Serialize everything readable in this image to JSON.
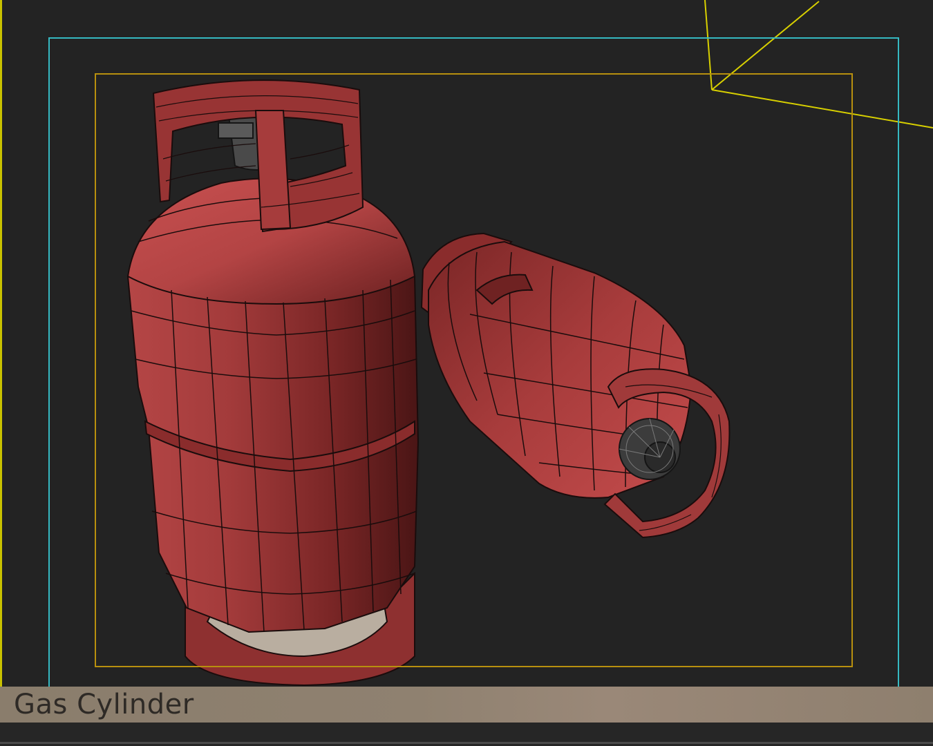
{
  "viewport": {
    "caption": "Gas Cylinder",
    "background_color": "#232323",
    "object_color": "#a03a3a",
    "wire_color": "#1a0c0c",
    "valve_color": "#4a4a4a",
    "safe_frame_outer_color": "#35b9c2",
    "safe_frame_inner_color": "#b8900e",
    "camera_gizmo_color": "#d8d000",
    "caption_bar_color": "#8f8170"
  },
  "scene": {
    "objects": [
      {
        "name": "gas-cylinder-upright",
        "orientation": "upright"
      },
      {
        "name": "gas-cylinder-tilted",
        "orientation": "lying"
      }
    ]
  }
}
